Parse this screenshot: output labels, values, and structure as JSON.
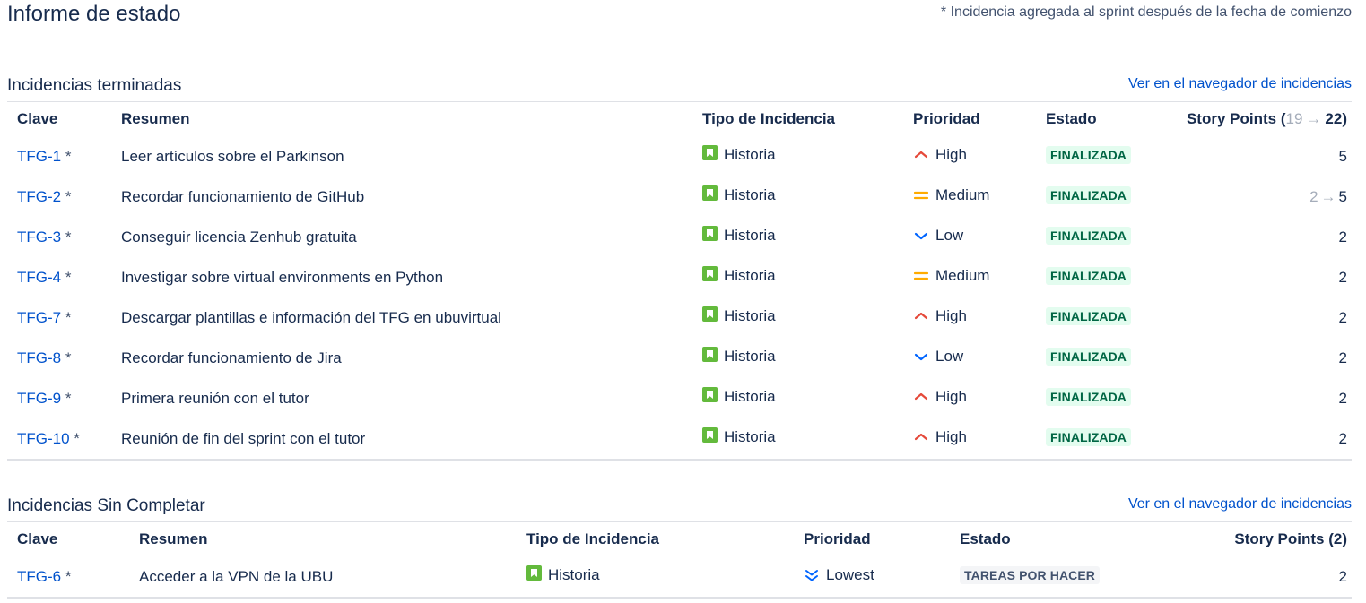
{
  "page": {
    "title": "Informe de estado",
    "note": "* Incidencia agregada al sprint después de la fecha de comienzo"
  },
  "colors": {
    "link": "#0052cc",
    "story": "#63ba3c",
    "high": "#e5493a",
    "medium": "#ffab00",
    "low": "#0065ff",
    "done_bg": "#e3fcef",
    "done_fg": "#006644"
  },
  "completed": {
    "title": "Incidencias terminadas",
    "link": "Ver en el navegador de incidencias",
    "headers": {
      "key": "Clave",
      "summary": "Resumen",
      "type": "Tipo de Incidencia",
      "priority": "Prioridad",
      "status": "Estado",
      "points_prefix": "Story Points (",
      "points_old": "19",
      "points_arrow": "→",
      "points_new": "22",
      "points_suffix": ")"
    },
    "rows": [
      {
        "key": "TFG-1",
        "star": "*",
        "summary": "Leer artículos sobre el Parkinson",
        "type": "Historia",
        "priority": "High",
        "priority_icon": "priority-high-icon",
        "status": "FINALIZADA",
        "points": "5"
      },
      {
        "key": "TFG-2",
        "star": "*",
        "summary": "Recordar funcionamiento de GitHub",
        "type": "Historia",
        "priority": "Medium",
        "priority_icon": "priority-medium-icon",
        "status": "FINALIZADA",
        "points_old": "2",
        "points_arrow": "→",
        "points": "5"
      },
      {
        "key": "TFG-3",
        "star": "*",
        "summary": "Conseguir licencia Zenhub gratuita",
        "type": "Historia",
        "priority": "Low",
        "priority_icon": "priority-low-icon",
        "status": "FINALIZADA",
        "points": "2"
      },
      {
        "key": "TFG-4",
        "star": "*",
        "summary": "Investigar sobre virtual environments en Python",
        "type": "Historia",
        "priority": "Medium",
        "priority_icon": "priority-medium-icon",
        "status": "FINALIZADA",
        "points": "2"
      },
      {
        "key": "TFG-7",
        "star": "*",
        "summary": "Descargar plantillas e información del TFG en ubuvirtual",
        "type": "Historia",
        "priority": "High",
        "priority_icon": "priority-high-icon",
        "status": "FINALIZADA",
        "points": "2"
      },
      {
        "key": "TFG-8",
        "star": "*",
        "summary": "Recordar funcionamiento de Jira",
        "type": "Historia",
        "priority": "Low",
        "priority_icon": "priority-low-icon",
        "status": "FINALIZADA",
        "points": "2"
      },
      {
        "key": "TFG-9",
        "star": "*",
        "summary": "Primera reunión con el tutor",
        "type": "Historia",
        "priority": "High",
        "priority_icon": "priority-high-icon",
        "status": "FINALIZADA",
        "points": "2"
      },
      {
        "key": "TFG-10",
        "star": "*",
        "summary": "Reunión de fin del sprint con el tutor",
        "type": "Historia",
        "priority": "High",
        "priority_icon": "priority-high-icon",
        "status": "FINALIZADA",
        "points": "2"
      }
    ]
  },
  "incomplete": {
    "title": "Incidencias Sin Completar",
    "link": "Ver en el navegador de incidencias",
    "headers": {
      "key": "Clave",
      "summary": "Resumen",
      "type": "Tipo de Incidencia",
      "priority": "Prioridad",
      "status": "Estado",
      "points": "Story Points (2)"
    },
    "rows": [
      {
        "key": "TFG-6",
        "star": "*",
        "summary": "Acceder a la VPN de la UBU",
        "type": "Historia",
        "priority": "Lowest",
        "priority_icon": "priority-lowest-icon",
        "status": "TAREAS POR HACER",
        "points": "2"
      }
    ]
  }
}
